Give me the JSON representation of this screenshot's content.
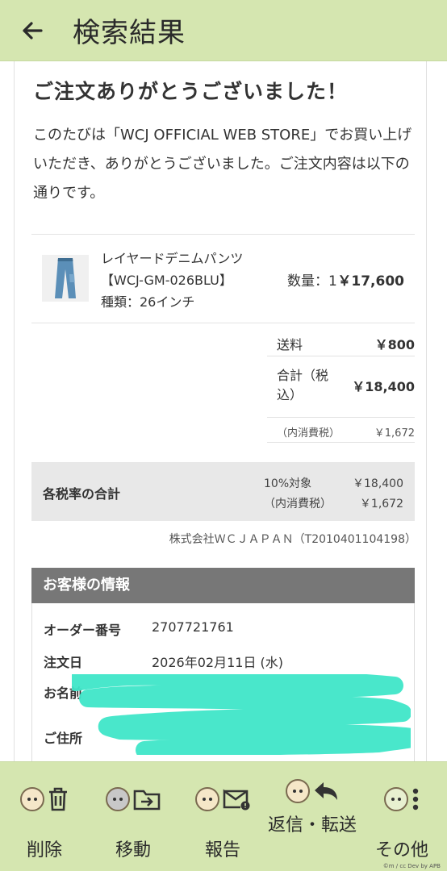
{
  "header": {
    "title": "検索結果",
    "back_icon": "arrow-left-icon"
  },
  "mail": {
    "thanks": "ご注文ありがとうございました！",
    "intro": "このたびは「WCJ OFFICIAL WEB STORE」でお買い上げいただき、ありがとうございました。ご注文内容は以下の通りです。",
    "product": {
      "name": "レイヤードデニムパンツ",
      "code": "【WCJ-GM-026BLU】",
      "variant": "種類：26インチ",
      "qty": "数量：1",
      "price": "￥17,600"
    },
    "summary": [
      {
        "label": "送料",
        "value": "￥800"
      },
      {
        "label": "合計（税込）",
        "value": "￥18,400"
      },
      {
        "label": "（内消費税）",
        "value": "￥1,672"
      }
    ],
    "tax": {
      "title": "各税率の合計",
      "rows": [
        {
          "label": "10%対象",
          "value": "￥18,400"
        },
        {
          "label": "（内消費税）",
          "value": "￥1,672"
        }
      ]
    },
    "company": "株式会社ＷＣＪＡＰＡＮ（T2010401104198）",
    "customer": {
      "heading": "お客様の情報",
      "rows": [
        {
          "label": "オーダー番号",
          "value": "2707721761"
        },
        {
          "label": "注文日",
          "value": "2026年02月11日 (水)"
        },
        {
          "label": "お名前",
          "value": ""
        },
        {
          "label": "ご住所",
          "value": ""
        }
      ]
    }
  },
  "toolbar": {
    "items": [
      {
        "label": "削除",
        "icon": "trash-icon"
      },
      {
        "label": "移動",
        "icon": "folder-move-icon"
      },
      {
        "label": "報告",
        "icon": "mail-alert-icon"
      },
      {
        "label": "返信・転送",
        "icon": "reply-icon"
      },
      {
        "label": "その他",
        "icon": "more-vertical-icon"
      }
    ],
    "credit": "©m / cc  Dev by APB"
  },
  "colors": {
    "header_bg": "#d5e6b0",
    "cust_head_bg": "#777777",
    "tax_bg": "#e8e8e8"
  }
}
